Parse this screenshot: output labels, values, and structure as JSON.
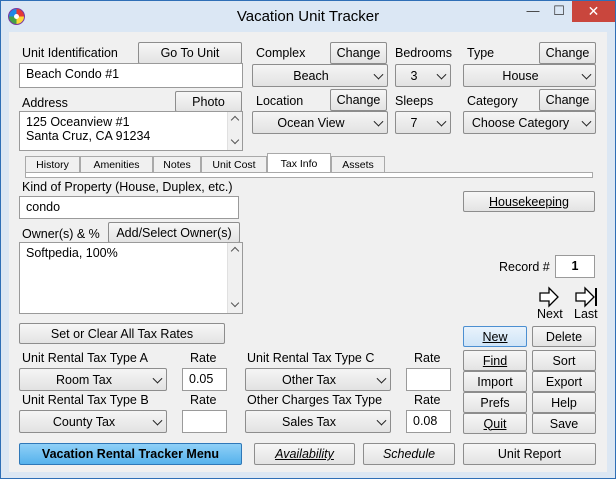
{
  "window": {
    "title": "Vacation Unit Tracker",
    "min_glyph": "—",
    "max_glyph": "☐",
    "close_glyph": "✕"
  },
  "unit": {
    "label": "Unit Identification",
    "goto_button": "Go To Unit",
    "value": "Beach Condo #1"
  },
  "address": {
    "label": "Address",
    "photo_button": "Photo",
    "line1": "125 Oceanview #1",
    "line2": "Santa Cruz, CA 91234"
  },
  "complex": {
    "label": "Complex",
    "change": "Change",
    "value": "Beach"
  },
  "location": {
    "label": "Location",
    "change": "Change",
    "value": "Ocean View"
  },
  "bedrooms": {
    "label": "Bedrooms",
    "value": "3"
  },
  "sleeps": {
    "label": "Sleeps",
    "value": "7"
  },
  "type": {
    "label": "Type",
    "change": "Change",
    "value": "House"
  },
  "category": {
    "label": "Category",
    "change": "Change",
    "value": "Choose Category"
  },
  "tabs": [
    "History",
    "Amenities",
    "Notes",
    "Unit Cost",
    "Tax Info",
    "Assets"
  ],
  "kind": {
    "label": "Kind of Property (House, Duplex, etc.)",
    "value": "condo"
  },
  "housekeeping_button": "Housekeeping",
  "owners": {
    "label": "Owner(s) & %",
    "add_button": "Add/Select Owner(s)",
    "value": "Softpedia, 100%"
  },
  "record": {
    "label": "Record #",
    "value": "1"
  },
  "nav": {
    "next": "Next",
    "last": "Last"
  },
  "tax": {
    "set_clear_button": "Set or Clear All Tax Rates",
    "rate_label": "Rate",
    "type_a_label": "Unit Rental Tax Type A",
    "type_a_value": "Room Tax",
    "type_a_rate": "0.05",
    "type_b_label": "Unit Rental Tax Type B",
    "type_b_value": "County Tax",
    "type_b_rate": "",
    "type_c_label": "Unit Rental Tax Type C",
    "type_c_value": "Other Tax",
    "type_c_rate": "",
    "other_label": "Other Charges Tax Type",
    "other_value": "Sales Tax",
    "other_rate": "0.08"
  },
  "actions": {
    "new": "New",
    "delete": "Delete",
    "find": "Find",
    "sort": "Sort",
    "import": "Import",
    "export": "Export",
    "prefs": "Prefs",
    "help": "Help",
    "quit": "Quit",
    "save": "Save"
  },
  "footer": {
    "menu": "Vacation Rental Tracker Menu",
    "availability": "Availability",
    "schedule": "Schedule",
    "unit_report": "Unit Report"
  }
}
